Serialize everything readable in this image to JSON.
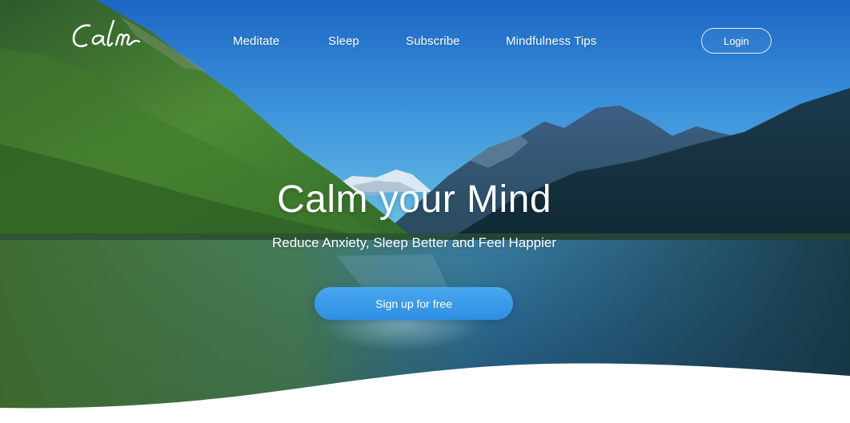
{
  "brand": {
    "logo_text": "Calm"
  },
  "nav": {
    "links": [
      {
        "label": "Meditate"
      },
      {
        "label": "Sleep"
      },
      {
        "label": "Subscribe"
      },
      {
        "label": "Mindfulness Tips"
      }
    ],
    "login_label": "Login"
  },
  "hero": {
    "title": "Calm your Mind",
    "subtitle": "Reduce Anxiety, Sleep Better and Feel Happier",
    "cta_label": "Sign up for free"
  },
  "colors": {
    "sky_top": "#1f6fc9",
    "sky_horizon": "#5cb8e0",
    "cta_blue": "#3a9bea",
    "text": "#ffffff"
  }
}
